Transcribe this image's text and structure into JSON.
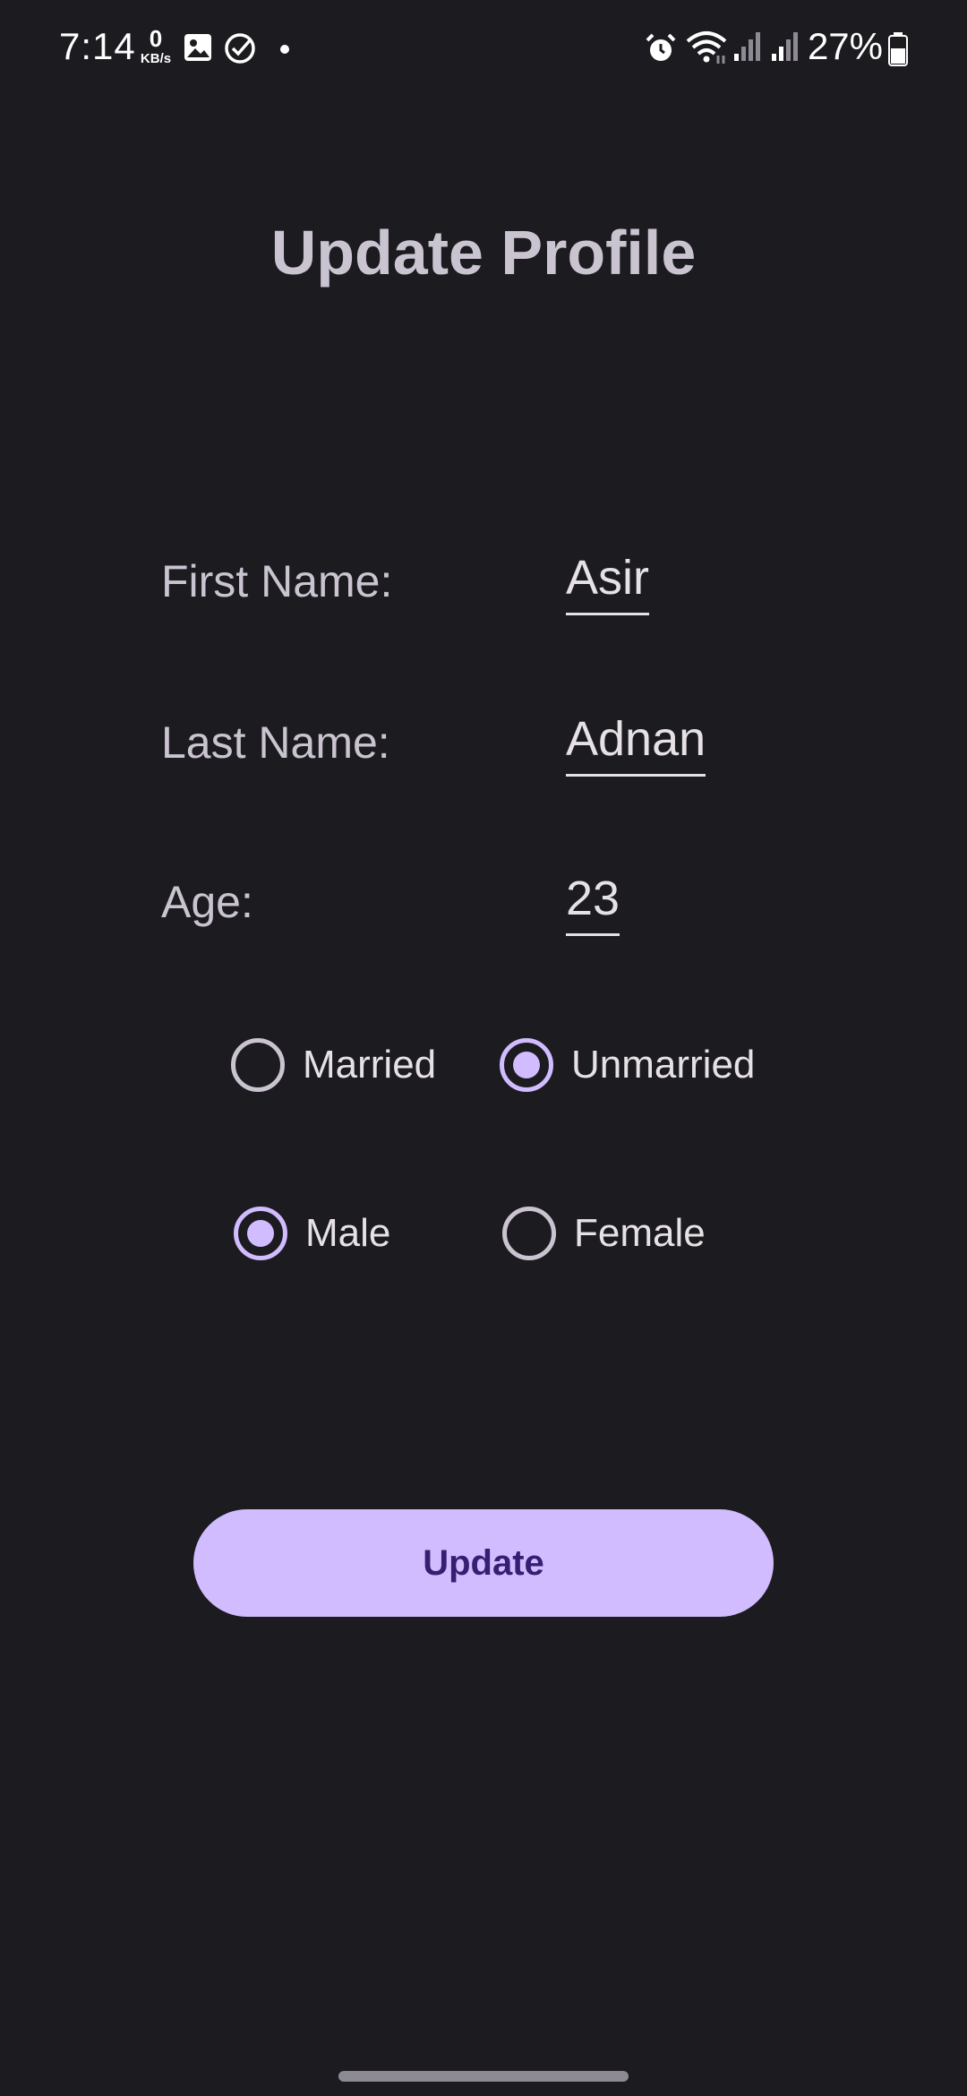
{
  "status_bar": {
    "time": "7:14",
    "net_speed_value": "0",
    "net_speed_unit": "KB/s",
    "battery": "27%",
    "icons": [
      "image-icon",
      "check-circle-icon",
      "dot-icon",
      "alarm-icon",
      "wifi-icon",
      "signal-icon",
      "signal-icon",
      "battery-icon"
    ]
  },
  "page": {
    "title": "Update Profile"
  },
  "form": {
    "first_name_label": "First Name:",
    "first_name_value": "Asir",
    "last_name_label": "Last Name:",
    "last_name_value": "Adnan",
    "age_label": "Age:",
    "age_value": "23"
  },
  "marital_status": {
    "options": [
      {
        "label": "Married",
        "checked": false
      },
      {
        "label": "Unmarried",
        "checked": true
      }
    ]
  },
  "gender": {
    "options": [
      {
        "label": "Male",
        "checked": true
      },
      {
        "label": "Female",
        "checked": false
      }
    ]
  },
  "actions": {
    "update_label": "Update"
  },
  "colors": {
    "background": "#1c1b1f",
    "accent": "#d0bcff",
    "on_accent": "#381e72",
    "label": "#cac4d0",
    "text": "#e6e1e5"
  }
}
